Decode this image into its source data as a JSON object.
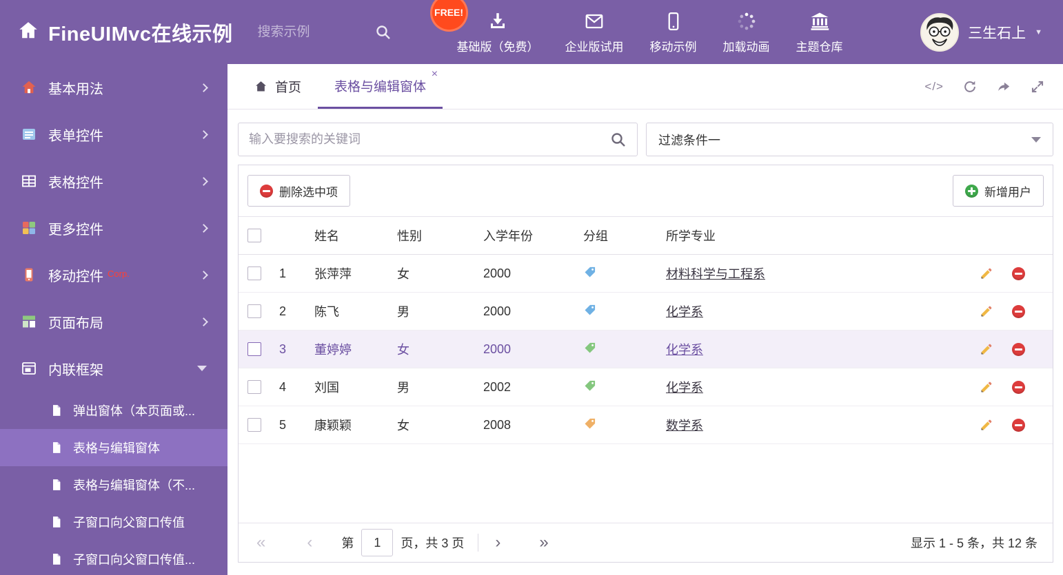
{
  "header": {
    "title": "FineUIMvc在线示例",
    "search_placeholder": "搜索示例",
    "free_badge": "FREE!",
    "nav": [
      {
        "label": "基础版（免费）",
        "icon": "download-icon"
      },
      {
        "label": "企业版试用",
        "icon": "envelope-icon"
      },
      {
        "label": "移动示例",
        "icon": "mobile-icon"
      },
      {
        "label": "加载动画",
        "icon": "loader-icon"
      },
      {
        "label": "主题仓库",
        "icon": "bank-icon"
      }
    ],
    "user_name": "三生石上"
  },
  "sidebar": {
    "items": [
      {
        "label": "基本用法",
        "icon": "home-icon"
      },
      {
        "label": "表单控件",
        "icon": "form-icon"
      },
      {
        "label": "表格控件",
        "icon": "table-icon"
      },
      {
        "label": "更多控件",
        "icon": "more-widgets-icon"
      },
      {
        "label": "移动控件",
        "badge": "Corp.",
        "icon": "mobile-widgets-icon"
      },
      {
        "label": "页面布局",
        "icon": "layout-icon"
      },
      {
        "label": "内联框架",
        "icon": "iframe-icon"
      }
    ],
    "subitems": [
      {
        "label": "弹出窗体（本页面或...",
        "active": false
      },
      {
        "label": "表格与编辑窗体",
        "active": true
      },
      {
        "label": "表格与编辑窗体（不...",
        "active": false
      },
      {
        "label": "子窗口向父窗口传值",
        "active": false
      },
      {
        "label": "子窗口向父窗口传值...",
        "active": false
      }
    ]
  },
  "tabs": {
    "home": "首页",
    "active_tab": "表格与编辑窗体",
    "close": "×",
    "code_icon_text": "</>"
  },
  "filter": {
    "search_placeholder": "输入要搜索的关键词",
    "dropdown_value": "过滤条件一"
  },
  "toolbar": {
    "delete_label": "删除选中项",
    "add_label": "新增用户"
  },
  "table": {
    "headers": [
      "姓名",
      "性别",
      "入学年份",
      "分组",
      "所学专业"
    ],
    "rows": [
      {
        "num": "1",
        "name": "张萍萍",
        "gender": "女",
        "year": "2000",
        "tag_color": "#6fb1e4",
        "major": "材料科学与工程系",
        "selected": false
      },
      {
        "num": "2",
        "name": "陈飞",
        "gender": "男",
        "year": "2000",
        "tag_color": "#6fb1e4",
        "major": "化学系",
        "selected": false
      },
      {
        "num": "3",
        "name": "董婷婷",
        "gender": "女",
        "year": "2000",
        "tag_color": "#84c77e",
        "major": "化学系",
        "selected": true
      },
      {
        "num": "4",
        "name": "刘国",
        "gender": "男",
        "year": "2002",
        "tag_color": "#84c77e",
        "major": "化学系",
        "selected": false
      },
      {
        "num": "5",
        "name": "康颖颖",
        "gender": "女",
        "year": "2008",
        "tag_color": "#efb066",
        "major": "数学系",
        "selected": false
      }
    ]
  },
  "pagination": {
    "first": "«",
    "prev": "‹",
    "page_prefix": "第",
    "current_page": "1",
    "page_suffix": "页，共 3 页",
    "next": "›",
    "last": "»",
    "summary": "显示 1 - 5 条，共 12 条"
  },
  "colors": {
    "theme_purple": "#7a5fa6",
    "accent_purple": "#6b4fa1",
    "selected_row_bg": "#f3eff9",
    "danger_red": "#dd3c3c",
    "success_green": "#3fa94c",
    "free_badge_bg": "#ff4a1d"
  }
}
